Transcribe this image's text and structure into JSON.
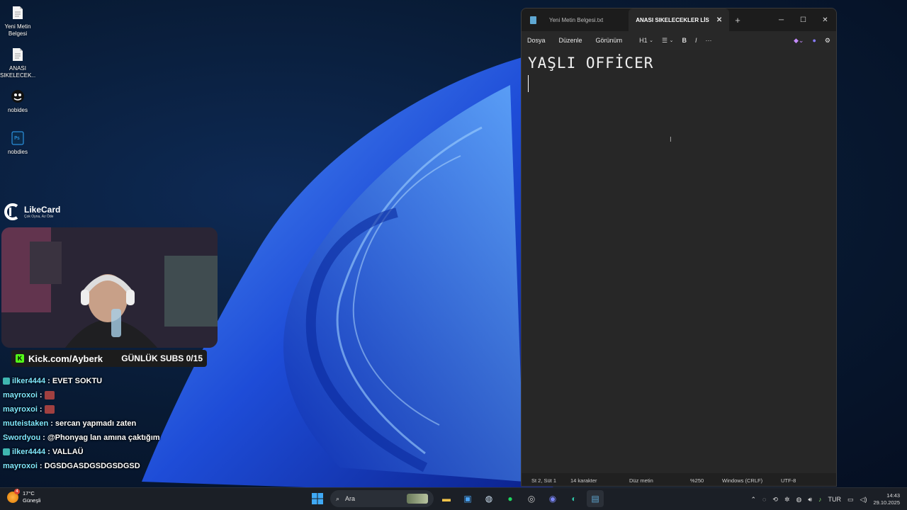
{
  "desktop": {
    "icons": [
      {
        "label": "Yeni Metin Belgesi",
        "icon": "text-file-icon"
      },
      {
        "label": "ANASI SIKELECEK...",
        "icon": "text-file-icon"
      },
      {
        "label": "nobides",
        "icon": "nobides-app-icon"
      },
      {
        "label": "nobdies",
        "icon": "photoshop-file-icon"
      }
    ]
  },
  "overlay": {
    "likecard_title": "LikeCard",
    "likecard_sub": "Çok Oyna, Az Öde",
    "kick_url": "Kick.com/Ayberk",
    "subs_goal": "GÜNLÜK SUBS 0/15",
    "chat": [
      {
        "user": "ilker4444",
        "msg": ": EVET SOKTU",
        "badge": true,
        "emote": false
      },
      {
        "user": "mayroxoi",
        "msg": ":",
        "badge": false,
        "emote": true
      },
      {
        "user": "mayroxoi",
        "msg": ":",
        "badge": false,
        "emote": true
      },
      {
        "user": "muteistaken",
        "msg": ": sercan yapmadı zaten",
        "badge": false,
        "emote": false
      },
      {
        "user": "Swordyou",
        "msg": ": @Phonyag lan amına çaktığım",
        "badge": false,
        "emote": false
      },
      {
        "user": "ilker4444",
        "msg": ": VALLAÜ",
        "badge": true,
        "emote": false
      },
      {
        "user": "mayroxoi",
        "msg": ": DGSDGASDGSDGSDGSD",
        "badge": false,
        "emote": false
      }
    ]
  },
  "notepad": {
    "tabs": [
      {
        "label": "Yeni Metin Belgesi.txt",
        "active": false
      },
      {
        "label": "ANASI SIKELECEKLER LİSTESİ",
        "active": true
      }
    ],
    "menu": [
      "Dosya",
      "Düzenle",
      "Görünüm"
    ],
    "heading_tool": "H1",
    "content": "YAŞLI OFFİCER",
    "status": {
      "position": "St 2, Süt 1",
      "chars": "14 karakter",
      "format": "Düz metin",
      "zoom": "%250",
      "line_ending": "Windows (CRLF)",
      "encoding": "UTF-8"
    }
  },
  "taskbar": {
    "weather_temp": "17°C",
    "weather_desc": "Güneşli",
    "weather_alert": "4",
    "search_placeholder": "Ara",
    "language": "TUR",
    "time": "14:43",
    "date": "29.10.2025"
  }
}
